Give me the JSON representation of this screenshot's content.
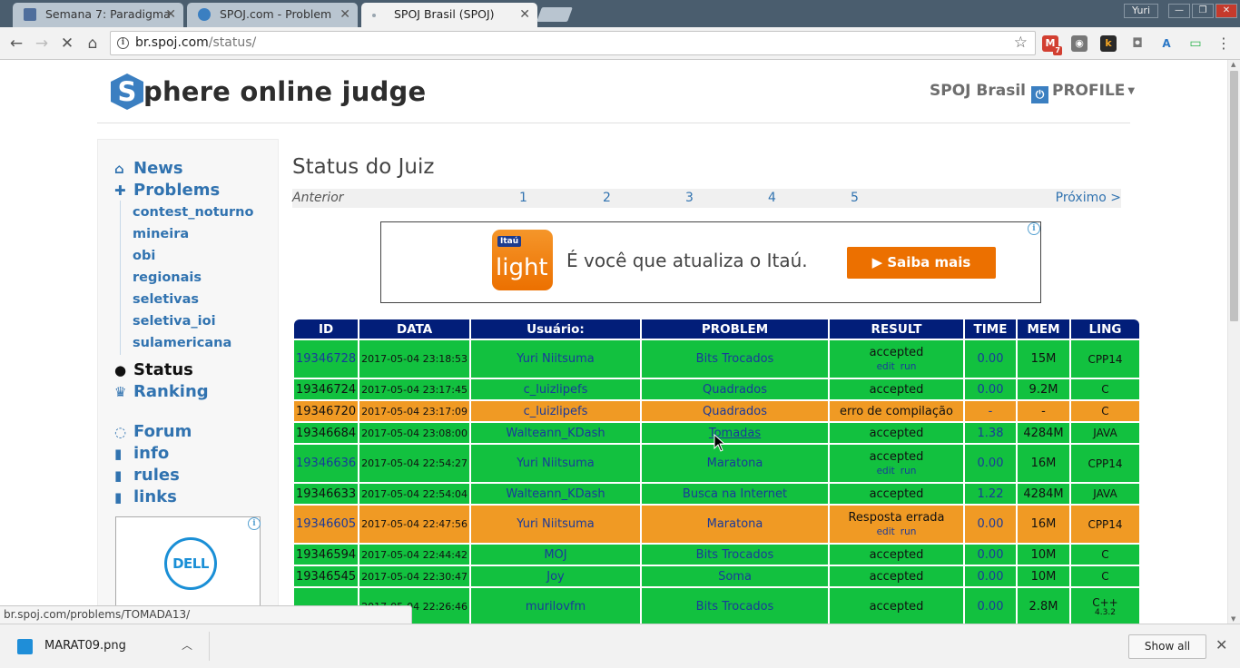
{
  "browser": {
    "tabs": [
      {
        "title": "Semana 7: Paradigma",
        "favicon_color": "#4f6e9c"
      },
      {
        "title": "SPOJ.com - Problem",
        "favicon_color": "#3b7fc1"
      },
      {
        "title": "SPOJ Brasil (SPOJ)",
        "favicon_color": "#9aa6b0"
      }
    ],
    "close_glyph": "✕",
    "user": "Yuri",
    "url_host": "br.spoj.com",
    "url_path": "/status/",
    "status_url": "br.spoj.com/problems/TOMADA13/",
    "extension_badge": "7"
  },
  "site": {
    "logo_letter": "S",
    "logo_rest": "phere online judge",
    "brand": "SPOJ Brasil",
    "profile": "PROFILE"
  },
  "sidebar": {
    "news": "News",
    "problems": "Problems",
    "sub_items": [
      "contest_noturno",
      "mineira",
      "obi",
      "regionais",
      "seletivas",
      "seletiva_ioi",
      "sulamericana"
    ],
    "status": "Status",
    "ranking": "Ranking",
    "forum": "Forum",
    "info": "info",
    "rules": "rules",
    "links": "links",
    "ad_brand": "DELL"
  },
  "main": {
    "title": "Status do Juiz",
    "pager": {
      "prev": "Anterior",
      "pages": [
        "1",
        "2",
        "3",
        "4",
        "5"
      ],
      "next": "Próximo >"
    },
    "ad": {
      "logo_small": "Itaú",
      "logo_big": "light",
      "text": "É você que atualiza o Itaú.",
      "cta": "▶  Saiba mais"
    }
  },
  "table": {
    "headers": [
      "ID",
      "DATA",
      "Usuário:",
      "PROBLEM",
      "RESULT",
      "TIME",
      "MEM",
      "LING"
    ],
    "edit_label": "edit",
    "run_label": "run",
    "rows": [
      {
        "id": "19346728",
        "date": "2017-05-04 23:18:53",
        "user": "Yuri Niitsuma",
        "problem": "Bits Trocados",
        "result": "accepted",
        "actions": true,
        "time": "0.00",
        "mem": "15M",
        "ling": "CPP14",
        "status": "ok",
        "id_link": true
      },
      {
        "id": "19346724",
        "date": "2017-05-04 23:17:45",
        "user": "c_luizlipefs",
        "problem": "Quadrados",
        "result": "accepted",
        "actions": false,
        "time": "0.00",
        "mem": "9.2M",
        "ling": "C",
        "status": "ok",
        "id_link": false
      },
      {
        "id": "19346720",
        "date": "2017-05-04 23:17:09",
        "user": "c_luizlipefs",
        "problem": "Quadrados",
        "result": "erro de compilação",
        "actions": false,
        "time": "-",
        "mem": "-",
        "ling": "C",
        "status": "warn",
        "id_link": false
      },
      {
        "id": "19346684",
        "date": "2017-05-04 23:08:00",
        "user": "Walteann_KDash",
        "problem": "Tomadas",
        "result": "accepted",
        "actions": false,
        "time": "1.38",
        "mem": "4284M",
        "ling": "JAVA",
        "status": "ok",
        "id_link": false
      },
      {
        "id": "19346636",
        "date": "2017-05-04 22:54:27",
        "user": "Yuri Niitsuma",
        "problem": "Maratona",
        "result": "accepted",
        "actions": true,
        "time": "0.00",
        "mem": "16M",
        "ling": "CPP14",
        "status": "ok",
        "id_link": true
      },
      {
        "id": "19346633",
        "date": "2017-05-04 22:54:04",
        "user": "Walteann_KDash",
        "problem": "Busca na Internet",
        "result": "accepted",
        "actions": false,
        "time": "1.22",
        "mem": "4284M",
        "ling": "JAVA",
        "status": "ok",
        "id_link": false
      },
      {
        "id": "19346605",
        "date": "2017-05-04 22:47:56",
        "user": "Yuri Niitsuma",
        "problem": "Maratona",
        "result": "Resposta errada",
        "actions": true,
        "time": "0.00",
        "mem": "16M",
        "ling": "CPP14",
        "status": "warn",
        "id_link": true
      },
      {
        "id": "19346594",
        "date": "2017-05-04 22:44:42",
        "user": "MOJ",
        "problem": "Bits Trocados",
        "result": "accepted",
        "actions": false,
        "time": "0.00",
        "mem": "10M",
        "ling": "C",
        "status": "ok",
        "id_link": false
      },
      {
        "id": "19346545",
        "date": "2017-05-04 22:30:47",
        "user": "Joy",
        "problem": "Soma",
        "result": "accepted",
        "actions": false,
        "time": "0.00",
        "mem": "10M",
        "ling": "C",
        "status": "ok",
        "id_link": false
      },
      {
        "id": "",
        "date": "2017-05-04 22:26:46",
        "user": "murilovfm",
        "problem": "Bits Trocados",
        "result": "accepted",
        "actions": false,
        "time": "0.00",
        "mem": "2.8M",
        "ling": "C++",
        "ling_sub": "4.3.2",
        "status": "ok",
        "id_link": false,
        "double": true
      }
    ]
  },
  "downloads": {
    "file": "MARAT09.png",
    "show_all": "Show all"
  }
}
